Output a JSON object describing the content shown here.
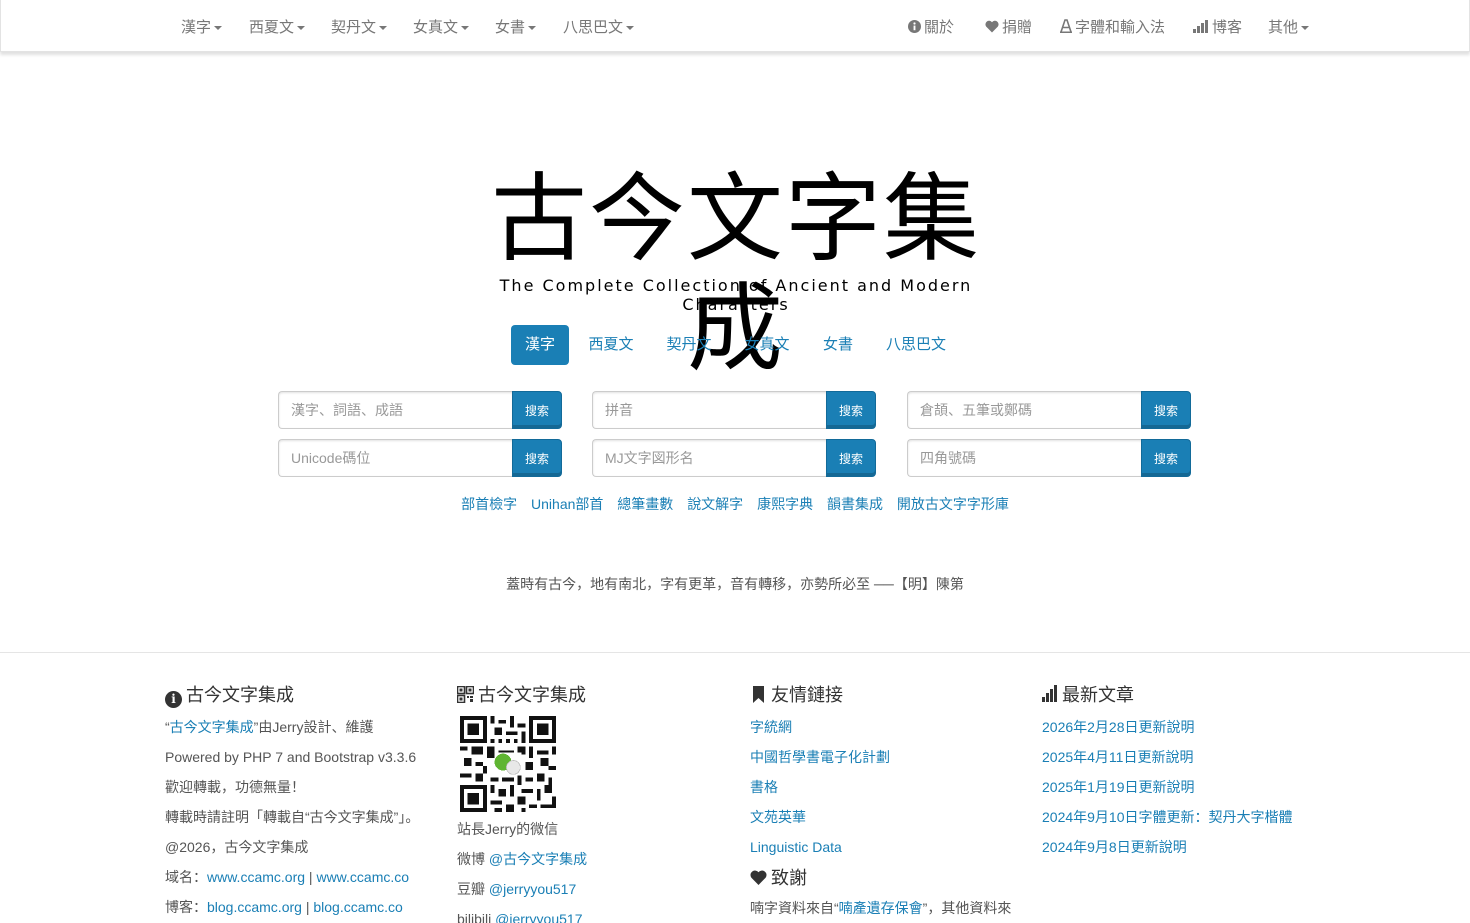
{
  "nav": {
    "left": [
      "漢字",
      "西夏文",
      "契丹文",
      "女真文",
      "女書",
      "八思巴文"
    ],
    "right": {
      "about": "關於",
      "donate": "捐贈",
      "fonts": "字體和輸入法",
      "blog": "博客",
      "other": "其他"
    }
  },
  "logo": {
    "title": "古今文字集成",
    "subtitle": "The Complete Collection of Ancient and Modern Characters"
  },
  "tabs": [
    "漢字",
    "西夏文",
    "契丹文",
    "女真文",
    "女書",
    "八思巴文"
  ],
  "active_tab": "漢字",
  "search": {
    "button_label": "搜索",
    "fields": [
      "漢字、詞語、成語",
      "拼音",
      "倉頡、五筆或鄭碼",
      "Unicode碼位",
      "MJ文字図形名",
      "四角號碼"
    ]
  },
  "quick_links": [
    "部首檢字",
    "Unihan部首",
    "總筆畫數",
    "說文解字",
    "康熙字典",
    "韻書集成",
    "開放古文字字形庫"
  ],
  "quote": "蓋時有古今，地有南北，字有更革，音有轉移，亦勢所必至 ──【明】陳第",
  "footer": {
    "about": {
      "title": "古今文字集成",
      "line1_open": "“",
      "line1_link": "古今文字集成",
      "line1_rest": "”由Jerry設計、維護",
      "line2": "Powered by PHP 7 and Bootstrap v3.3.6",
      "line3": "歡迎轉載，功德無量！",
      "line4": "轉載時請註明「轉載自“古今文字集成”」。",
      "line5": "@2026，古今文字集成",
      "domain_label": "域名：",
      "domain1": "www.ccamc.org",
      "domain_sep": " | ",
      "domain2": "www.ccamc.co",
      "blog_label": "博客：",
      "blog1": "blog.ccamc.org",
      "blog_sep": " | ",
      "blog2": "blog.ccamc.co"
    },
    "social": {
      "title": "古今文字集成",
      "qr_caption": "站長Jerry的微信",
      "weibo_label": "微博 ",
      "weibo": "@古今文字集成",
      "douban_label": "豆瓣 ",
      "douban": "@jerryyou517",
      "bilibili_label": "bilibili ",
      "bilibili": "@jerryyou517"
    },
    "friends": {
      "title": "友情鏈接",
      "links": [
        "字統網",
        "中國哲學書電子化計劃",
        "書格",
        "文苑英華",
        "Linguistic Data"
      ],
      "thanks_title": "致謝",
      "thanks_prefix": "喃字資料來自“",
      "thanks_link": "喃產遺存保會",
      "thanks_suffix": "”，其他資料來"
    },
    "news": {
      "title": "最新文章",
      "items": [
        "2026年2月28日更新說明",
        "2025年4月11日更新說明",
        "2025年1月19日更新說明",
        "2024年9月10日字體更新：契丹大字楷體",
        "2024年9月8日更新說明"
      ]
    }
  },
  "colors": {
    "accent": "#1a7fb5",
    "text": "#555555",
    "nav_text": "#777777"
  }
}
